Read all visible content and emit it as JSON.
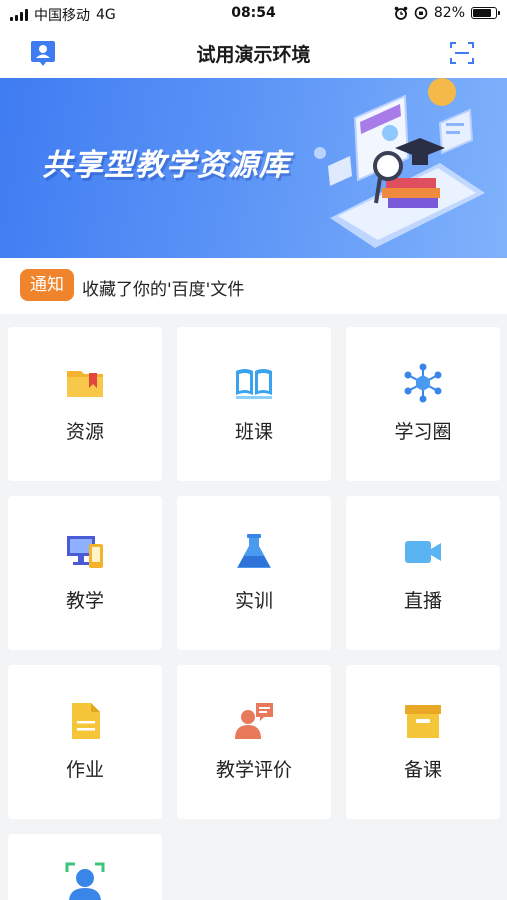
{
  "status_bar": {
    "carrier": "中国移动",
    "network": "4G",
    "time": "08:54",
    "battery": "82%",
    "battery_level": 0.82
  },
  "header": {
    "title": "试用演示环境",
    "left_icon": "user-badge-icon",
    "right_icon": "scan-icon"
  },
  "banner": {
    "text": "共享型教学资源库"
  },
  "notice": {
    "badge": "通知",
    "text": "收藏了你的'百度'文件"
  },
  "tiles": [
    {
      "label": "资源",
      "icon": "folder-icon"
    },
    {
      "label": "班课",
      "icon": "book-icon"
    },
    {
      "label": "学习圈",
      "icon": "network-icon"
    },
    {
      "label": "教学",
      "icon": "computer-icon"
    },
    {
      "label": "实训",
      "icon": "flask-icon"
    },
    {
      "label": "直播",
      "icon": "camera-icon"
    },
    {
      "label": "作业",
      "icon": "document-icon"
    },
    {
      "label": "教学评价",
      "icon": "speaker-comment-icon"
    },
    {
      "label": "备课",
      "icon": "archive-box-icon"
    },
    {
      "label": "",
      "icon": "face-recognition-icon"
    }
  ],
  "colors": {
    "primary": "#3f7cf2",
    "notice": "#f0842c",
    "background": "#f2f4f6"
  }
}
